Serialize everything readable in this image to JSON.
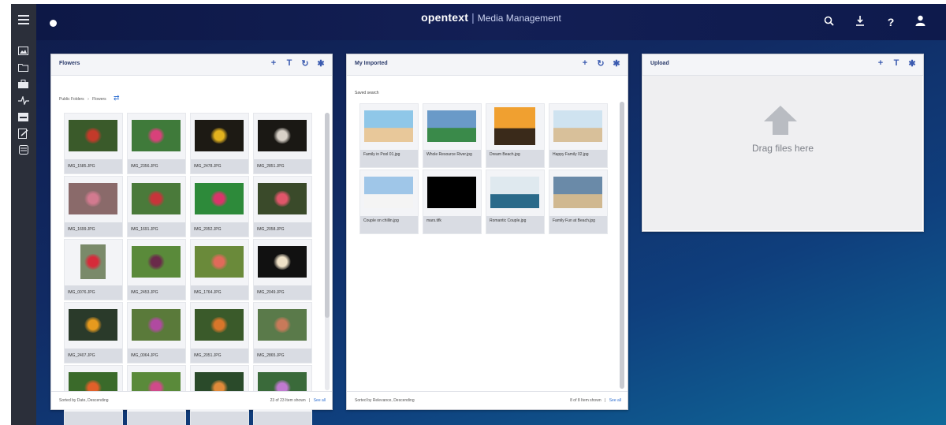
{
  "app": {
    "brand": "opentext",
    "separator": "|",
    "product": "Media Management"
  },
  "icons": {
    "left": [
      "menu-icon",
      "image-icon",
      "folder-icon",
      "briefcase-icon",
      "activity-icon",
      "inbox-icon",
      "edit-doc-icon",
      "stack-icon"
    ],
    "top": [
      "search-icon",
      "download-icon",
      "help-icon",
      "user-icon"
    ]
  },
  "panels": {
    "flowers": {
      "title": "Flowers",
      "breadcrumb_root": "Public Folders",
      "breadcrumb_sep": "›",
      "breadcrumb_current": "Flowers",
      "footer_left": "Sorted by Date, Descending",
      "footer_count": "23 of 23 Item shown",
      "footer_sep": "|",
      "footer_seeall": "See all",
      "items": [
        {
          "label": "IMG_1585.JPG",
          "color": "#c33a2a",
          "bg": "#3a5a2a"
        },
        {
          "label": "IMG_2356.JPG",
          "color": "#d8417a",
          "bg": "#3f7a3a"
        },
        {
          "label": "IMG_2478.JPG",
          "color": "#e2b21e",
          "bg": "#1d1a14"
        },
        {
          "label": "IMG_2851.JPG",
          "color": "#d8d1c8",
          "bg": "#1a1814"
        },
        {
          "label": "IMG_1699.JPG",
          "color": "#d27a8f",
          "bg": "#8a6a6a"
        },
        {
          "label": "IMG_1691.JPG",
          "color": "#c8343a",
          "bg": "#4a7a3a"
        },
        {
          "label": "IMG_2052.JPG",
          "color": "#d9356a",
          "bg": "#2d8a3a"
        },
        {
          "label": "IMG_2058.JPG",
          "color": "#e0566a",
          "bg": "#3a4a2a"
        },
        {
          "label": "IMG_0076.JPG",
          "color": "#d62a3a",
          "bg": "#7a8a6a"
        },
        {
          "label": "IMG_2453.JPG",
          "color": "#6a2a4a",
          "bg": "#5a8a3a"
        },
        {
          "label": "IMG_1764.JPG",
          "color": "#e06a5a",
          "bg": "#6a8a3a"
        },
        {
          "label": "IMG_2049.JPG",
          "color": "#efe2c8",
          "bg": "#111"
        },
        {
          "label": "IMG_2407.JPG",
          "color": "#e69a1e",
          "bg": "#2a3a2a"
        },
        {
          "label": "IMG_0064.JPG",
          "color": "#b04aa0",
          "bg": "#5a7a3a"
        },
        {
          "label": "IMG_2051.JPG",
          "color": "#d8762a",
          "bg": "#3a5a2a"
        },
        {
          "label": "IMG_2865.JPG",
          "color": "#c87a5a",
          "bg": "#5a7a4a"
        },
        {
          "label": "",
          "color": "#e0602a",
          "bg": "#3a6a2a"
        },
        {
          "label": "",
          "color": "#d04a8a",
          "bg": "#5a8a3a"
        },
        {
          "label": "",
          "color": "#e08a3a",
          "bg": "#2a4a2a"
        },
        {
          "label": "",
          "color": "#c07ad0",
          "bg": "#3a6a3a"
        }
      ]
    },
    "imported": {
      "title": "My Imported",
      "section": "Saved search",
      "footer_left": "Sorted by Relevance, Descending",
      "footer_count": "8 of 8 Item shown",
      "footer_sep": "|",
      "footer_seeall": "See all",
      "items": [
        {
          "label": "Family in Pool 01.jpg",
          "sky": "#8fc7e8",
          "ground": "#e8c89a"
        },
        {
          "label": "Whole Resource River.jpg",
          "sky": "#6a9ac8",
          "ground": "#3a8a4a"
        },
        {
          "label": "Dream Beach.jpg",
          "sky": "#f0a030",
          "ground": "#3a2a1a"
        },
        {
          "label": "Happy Family 02.jpg",
          "sky": "#cfe3f0",
          "ground": "#d8c09a"
        },
        {
          "label": "Couple on chillin.jpg",
          "sky": "#9fc6e8",
          "ground": "#f4f4f4"
        },
        {
          "label": "mars.tifk",
          "sky": "#000000",
          "ground": "#000000"
        },
        {
          "label": "Romantic Couple.jpg",
          "sky": "#dfe9ef",
          "ground": "#2a6a8a"
        },
        {
          "label": "Family Fun at Beach.jpg",
          "sky": "#6a8aa8",
          "ground": "#d0b890"
        }
      ]
    },
    "upload": {
      "title": "Upload",
      "drag_text": "Drag files here"
    }
  }
}
